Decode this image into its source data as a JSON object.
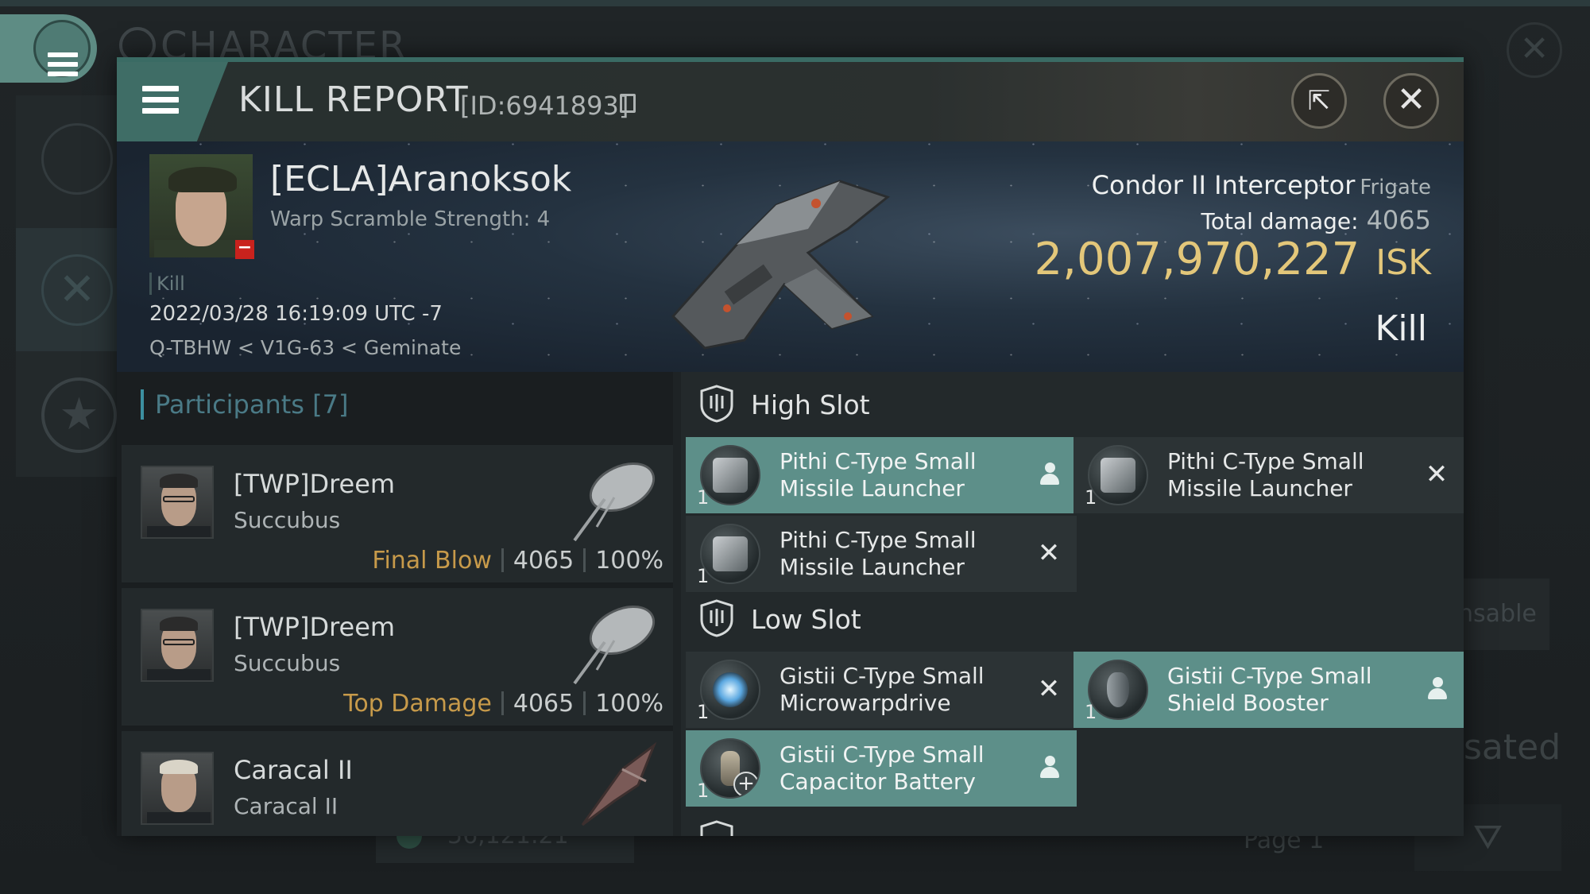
{
  "background": {
    "window_title": "CHARACTER",
    "right_label_fragment": "nsable",
    "right_text_fragment": "sated",
    "bottom_value": "56,121.21",
    "bottom_page": "Page 1"
  },
  "header": {
    "title": "KILL REPORT",
    "report_id": "[ID:6941893]"
  },
  "victim": {
    "name": "[ECLA]Aranoksok",
    "warp_scramble": "Warp Scramble Strength: 4",
    "tag": "Kill",
    "datetime": "2022/03/28 16:19:09 UTC -7",
    "location": "Q-TBHW < V1G-63 < Geminate",
    "ship_name": "Condor II Interceptor",
    "ship_class": "Frigate",
    "total_damage_label": "Total damage:",
    "total_damage": "4065",
    "isk_value": "2,007,970,227",
    "isk_unit": "ISK",
    "result": "Kill"
  },
  "participants": {
    "title": "Participants [7]",
    "rows": [
      {
        "name": "[TWP]Dreem",
        "ship": "Succubus",
        "label": "Final Blow",
        "damage": "4065",
        "percent": "100%"
      },
      {
        "name": "[TWP]Dreem",
        "ship": "Succubus",
        "label": "Top Damage",
        "damage": "4065",
        "percent": "100%"
      },
      {
        "name": "Caracal II",
        "ship": "Caracal II",
        "label": "",
        "damage": "",
        "percent": ""
      }
    ]
  },
  "fitting": {
    "high_slot": {
      "title": "High Slot",
      "modules": [
        {
          "qty": "1",
          "name": "Pithi C-Type Small Missile Launcher",
          "state": "fitted"
        },
        {
          "qty": "1",
          "name": "Pithi C-Type Small Missile Launcher",
          "state": "destroyed"
        },
        {
          "qty": "1",
          "name": "Pithi C-Type Small Missile Launcher",
          "state": "destroyed"
        }
      ]
    },
    "low_slot": {
      "title": "Low Slot",
      "modules": [
        {
          "qty": "1",
          "name": "Gistii C-Type Small Microwarpdrive",
          "state": "destroyed"
        },
        {
          "qty": "1",
          "name": "Gistii C-Type Small Shield Booster",
          "state": "fitted"
        },
        {
          "qty": "1",
          "name": "Gistii C-Type Small Capacitor Battery",
          "state": "fitted"
        }
      ]
    }
  },
  "colors": {
    "accent": "#5d8f89",
    "isk": "#e3c77a",
    "final_blow": "#c79a4a",
    "victim_badge": "#c9221d"
  },
  "icons": {
    "menu": "hamburger-icon",
    "share": "external-link-icon",
    "close": "close-icon",
    "copy": "copy-icon",
    "slot": "slot-shield-icon",
    "fitted": "person-icon",
    "destroyed": "x-icon"
  }
}
